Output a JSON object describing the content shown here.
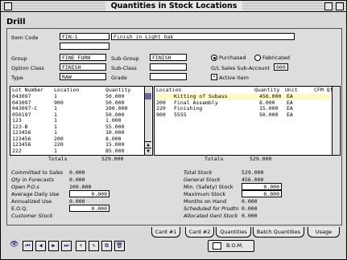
{
  "window": {
    "title": "Quantities in Stock Locations"
  },
  "header": {
    "title": "Drill"
  },
  "form": {
    "item_code_label": "Item Code",
    "item_code": "FIN-1",
    "description": "Finish in Light Oak",
    "group_label": "Group",
    "group": "FINE FURN",
    "subgroup_label": "Sub-Group",
    "subgroup": "FINISH",
    "option_class_label": "Option Class",
    "option_class": "FINISH",
    "subclass_label": "Sub-Class",
    "subclass": "",
    "type_label": "Type",
    "type": "RAW",
    "grade_label": "Grade",
    "grade": "",
    "purchased_label": "Purchased",
    "fabricated_label": "Fabricated",
    "gl_label": "G/L Sales Sub-Account",
    "gl_value": "000",
    "active_label": "Active Item"
  },
  "lots": {
    "headers": [
      "Lot Number",
      "Location",
      "Quantity"
    ],
    "rows": [
      [
        "043097",
        "1",
        "50.000"
      ],
      [
        "043097",
        "900",
        "50.000"
      ],
      [
        "043097-C",
        "1",
        "200.000"
      ],
      [
        "050197",
        "1",
        "50.000"
      ],
      [
        "123",
        "1",
        "1.000"
      ],
      [
        "123-B",
        "1",
        "55.000"
      ],
      [
        "123456",
        "1",
        "10.000"
      ],
      [
        "123456",
        "200",
        "8.000"
      ],
      [
        "123456",
        "220",
        "15.000"
      ],
      [
        "222",
        "1",
        "85.000"
      ]
    ],
    "totals_label": "Totals",
    "total": "529.000"
  },
  "locations": {
    "headers": [
      "Location",
      "Quantity",
      "Unit",
      "CFM Qty"
    ],
    "rows": [
      [
        "",
        "Kitting of Subass",
        "456.000",
        "EA"
      ],
      [
        "200",
        "Final Assembly",
        "8.000",
        "EA"
      ],
      [
        "220",
        "Finishing",
        "15.000",
        "EA"
      ],
      [
        "900",
        "5555",
        "50.000",
        "EA"
      ]
    ],
    "totals_label": "Totals",
    "total": "529.000"
  },
  "summary_left": [
    {
      "label": "Committed to Sales",
      "value": "0.000",
      "style": "ital"
    },
    {
      "label": "Qty in Forecasts",
      "value": "0.000",
      "style": "ital"
    },
    {
      "label": "Open P.O.s",
      "value": "200.000",
      "style": "ital"
    },
    {
      "label": "Average Daily Use",
      "value": "0.000",
      "style": "box"
    },
    {
      "label": "Annualized Use",
      "value": "0.000",
      "style": "plain"
    },
    {
      "label": "E.O.Q.",
      "value": "0.000",
      "style": "box"
    },
    {
      "label": "Customer Stock",
      "value": "",
      "style": "ital"
    }
  ],
  "summary_right": [
    {
      "label": "Total Stock",
      "value": "529.000",
      "style": "ital"
    },
    {
      "label": "General Stock",
      "value": "456.000",
      "style": "ital"
    },
    {
      "label": "Min. (Safety) Stock",
      "value": "0.000",
      "style": "box"
    },
    {
      "label": "Maximum Stock",
      "value": "0.000",
      "style": "box"
    },
    {
      "label": "Months on Hand",
      "value": "0.000",
      "style": "plain"
    },
    {
      "label": "Scheduled for Prodtn",
      "value": "0.000",
      "style": "ital"
    },
    {
      "label": "Allocated Genl Stock",
      "value": "0.000",
      "style": "ital"
    }
  ],
  "tabs": [
    "Card #1",
    "Card #2",
    "Quantities",
    "Batch Quantities",
    "Usage"
  ],
  "footer": {
    "bom_label": "B.O.M."
  }
}
